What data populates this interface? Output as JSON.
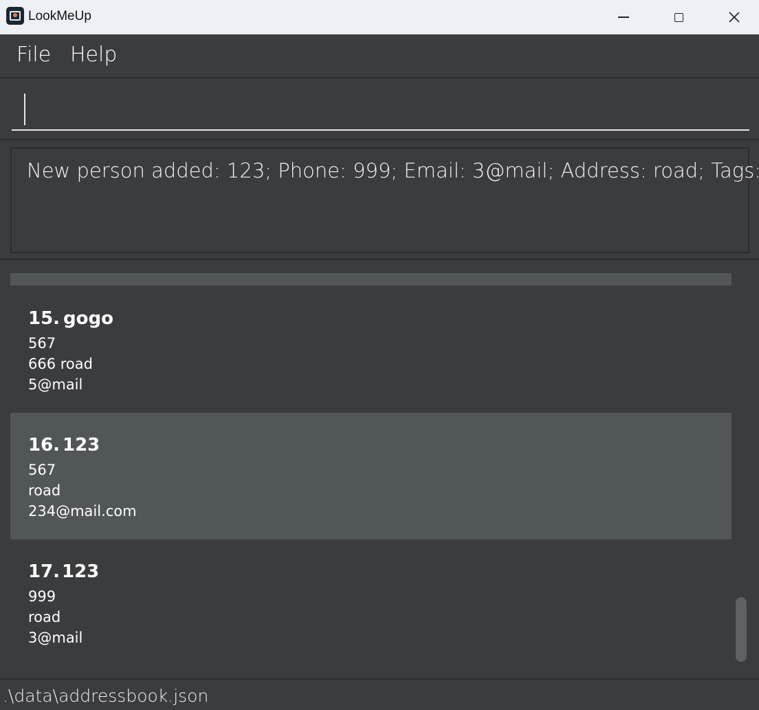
{
  "window": {
    "title": "LookMeUp",
    "icons": {
      "app": "app-book-icon",
      "minimize": "minimize-icon",
      "maximize": "maximize-icon",
      "close": "close-icon"
    },
    "close_glyph": "✕"
  },
  "menu": {
    "file": "File",
    "help": "Help"
  },
  "command_box": {
    "value": "",
    "placeholder": ""
  },
  "result": {
    "message": "New person added: 123; Phone: 999; Email: 3@mail; Address: road; Tags:"
  },
  "persons": [
    {
      "index": "15.",
      "name": "gogo",
      "phone": "567",
      "address": "666 road",
      "email": "5@mail",
      "selected": false
    },
    {
      "index": "16.",
      "name": "123",
      "phone": "567",
      "address": "road",
      "email": "234@mail.com",
      "selected": true
    },
    {
      "index": "17.",
      "name": "123",
      "phone": "999",
      "address": "road",
      "email": "3@mail",
      "selected": false
    }
  ],
  "status": {
    "file_path": ".\\data\\addressbook.json"
  },
  "colors": {
    "background": "#3b3c3e",
    "selected_card": "#515658",
    "titlebar": "#eef0f6",
    "separator": "#2c2d2f"
  }
}
